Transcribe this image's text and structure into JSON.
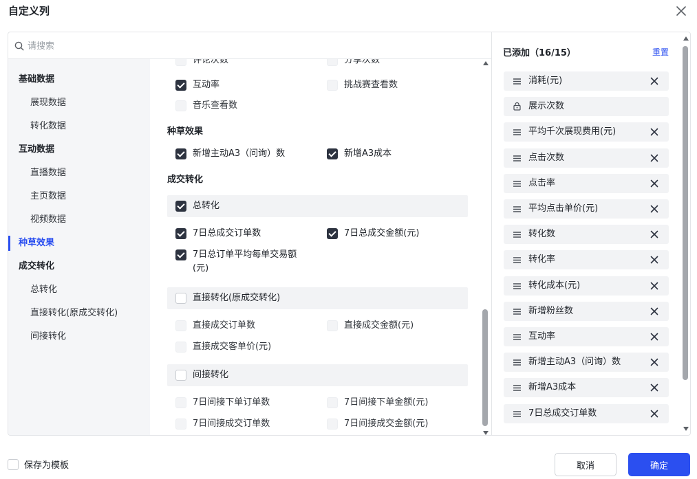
{
  "dialog": {
    "title": "自定义列",
    "search_placeholder": "请搜索",
    "close_icon": "close-icon"
  },
  "nav": [
    {
      "label": "基础数据",
      "kind": "group"
    },
    {
      "label": "展现数据",
      "kind": "sub"
    },
    {
      "label": "转化数据",
      "kind": "sub"
    },
    {
      "label": "互动数据",
      "kind": "group"
    },
    {
      "label": "直播数据",
      "kind": "sub"
    },
    {
      "label": "主页数据",
      "kind": "sub"
    },
    {
      "label": "视频数据",
      "kind": "sub"
    },
    {
      "label": "种草效果",
      "kind": "active"
    },
    {
      "label": "成交转化",
      "kind": "group"
    },
    {
      "label": "总转化",
      "kind": "sub"
    },
    {
      "label": "直接转化(原成交转化)",
      "kind": "sub"
    },
    {
      "label": "间接转化",
      "kind": "sub"
    }
  ],
  "list": {
    "partial_top": [
      "评论次数",
      "分享次数"
    ],
    "interaction": [
      {
        "label": "互动率",
        "state": "on"
      },
      {
        "label": "挑战赛查看数",
        "state": "disabled"
      },
      {
        "label": "音乐查看数",
        "state": "disabled"
      }
    ],
    "zhongcao": {
      "title": "种草效果",
      "items": [
        {
          "label": "新增主动A3（问询）数",
          "state": "on"
        },
        {
          "label": "新增A3成本",
          "state": "on"
        }
      ]
    },
    "chengjiao": {
      "title": "成交转化",
      "total": {
        "label": "总转化",
        "state": "on",
        "items": [
          {
            "label": "7日总成交订单数",
            "state": "on"
          },
          {
            "label": "7日总成交金额(元)",
            "state": "on"
          },
          {
            "label": "7日总订单平均每单交易额(元)",
            "state": "on"
          }
        ]
      },
      "direct": {
        "label": "直接转化(原成交转化)",
        "state": "off",
        "items": [
          {
            "label": "直接成交订单数",
            "state": "disabled"
          },
          {
            "label": "直接成交金额(元)",
            "state": "disabled"
          },
          {
            "label": "直接成交客单价(元)",
            "state": "disabled"
          }
        ]
      },
      "indirect": {
        "label": "间接转化",
        "state": "off",
        "items": [
          {
            "label": "7日间接下单订单数",
            "state": "disabled"
          },
          {
            "label": "7日间接下单金额(元)",
            "state": "disabled"
          },
          {
            "label": "7日间接成交订单数",
            "state": "disabled"
          },
          {
            "label": "7日间接成交金额(元)",
            "state": "disabled"
          }
        ]
      }
    }
  },
  "added": {
    "title": "已添加（16/15）",
    "reset_label": "重置",
    "items": [
      {
        "label": "消耗(元)",
        "locked": false
      },
      {
        "label": "展示次数",
        "locked": true
      },
      {
        "label": "平均千次展现费用(元)",
        "locked": false
      },
      {
        "label": "点击次数",
        "locked": false
      },
      {
        "label": "点击率",
        "locked": false
      },
      {
        "label": "平均点击单价(元)",
        "locked": false
      },
      {
        "label": "转化数",
        "locked": false
      },
      {
        "label": "转化率",
        "locked": false
      },
      {
        "label": "转化成本(元)",
        "locked": false
      },
      {
        "label": "新增粉丝数",
        "locked": false
      },
      {
        "label": "互动率",
        "locked": false
      },
      {
        "label": "新增主动A3（问询）数",
        "locked": false
      },
      {
        "label": "新增A3成本",
        "locked": false
      },
      {
        "label": "7日总成交订单数",
        "locked": false
      }
    ]
  },
  "footer": {
    "save_template_label": "保存为模板",
    "cancel_label": "取消",
    "confirm_label": "确定"
  },
  "colors": {
    "accent": "#2b4ff0",
    "checkbox_checked": "#2d3340",
    "nav_bg": "#f5f6f8"
  }
}
